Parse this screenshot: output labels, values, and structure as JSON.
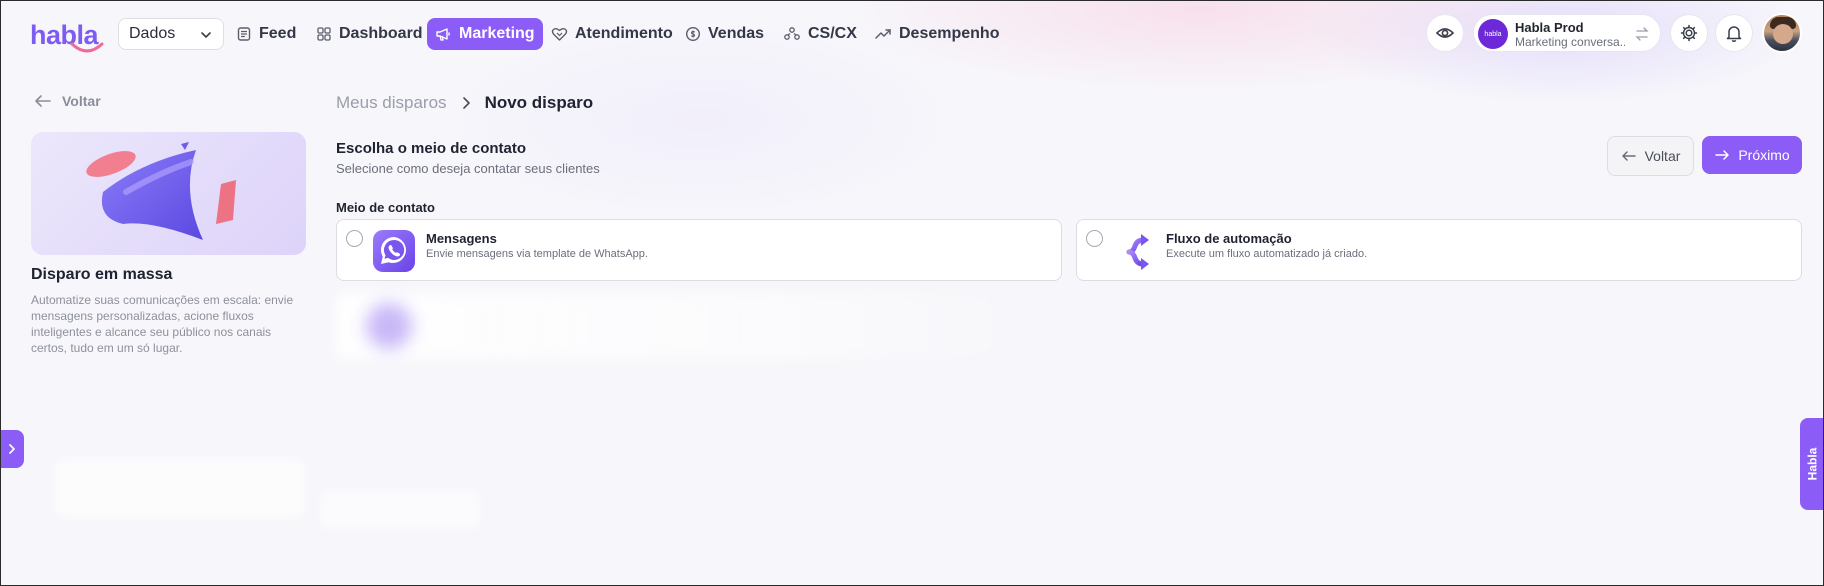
{
  "brand": {
    "logo_text": "habla",
    "accent": "#8b5cf6"
  },
  "header": {
    "workspace_select": "Dados",
    "nav": [
      {
        "label": "Feed",
        "icon": "feed-icon",
        "active": false
      },
      {
        "label": "Dashboard",
        "icon": "dashboard-icon",
        "active": false
      },
      {
        "label": "Marketing",
        "icon": "megaphone-icon",
        "active": true
      },
      {
        "label": "Atendimento",
        "icon": "heart-handshake-icon",
        "active": false
      },
      {
        "label": "Vendas",
        "icon": "dollar-icon",
        "active": false
      },
      {
        "label": "CS/CX",
        "icon": "people-icon",
        "active": false
      },
      {
        "label": "Desempenho",
        "icon": "trend-icon",
        "active": false
      }
    ],
    "account": {
      "name": "Habla Prod",
      "subtitle": "Marketing conversa...",
      "avatar_text": "habla"
    }
  },
  "sidebar": {
    "back_label": "Voltar",
    "title": "Disparo em massa",
    "description": "Automatize suas comunicações em escala: envie mensagens personalizadas, acione fluxos inteligentes e alcance seu público nos canais certos, tudo em um só lugar."
  },
  "breadcrumb": {
    "parent": "Meus disparos",
    "current": "Novo disparo"
  },
  "step": {
    "title": "Escolha o meio de contato",
    "subtitle": "Selecione como deseja contatar seus clientes",
    "back_button": "Voltar",
    "next_button": "Próximo",
    "field_label": "Meio de contato"
  },
  "options": [
    {
      "title": "Mensagens",
      "description": "Envie mensagens via template de WhatsApp.",
      "icon": "whatsapp-icon",
      "selected": false
    },
    {
      "title": "Fluxo de automação",
      "description": "Execute um fluxo automatizado já criado.",
      "icon": "flow-icon",
      "selected": false
    }
  ],
  "side_tab_label": "Habla"
}
